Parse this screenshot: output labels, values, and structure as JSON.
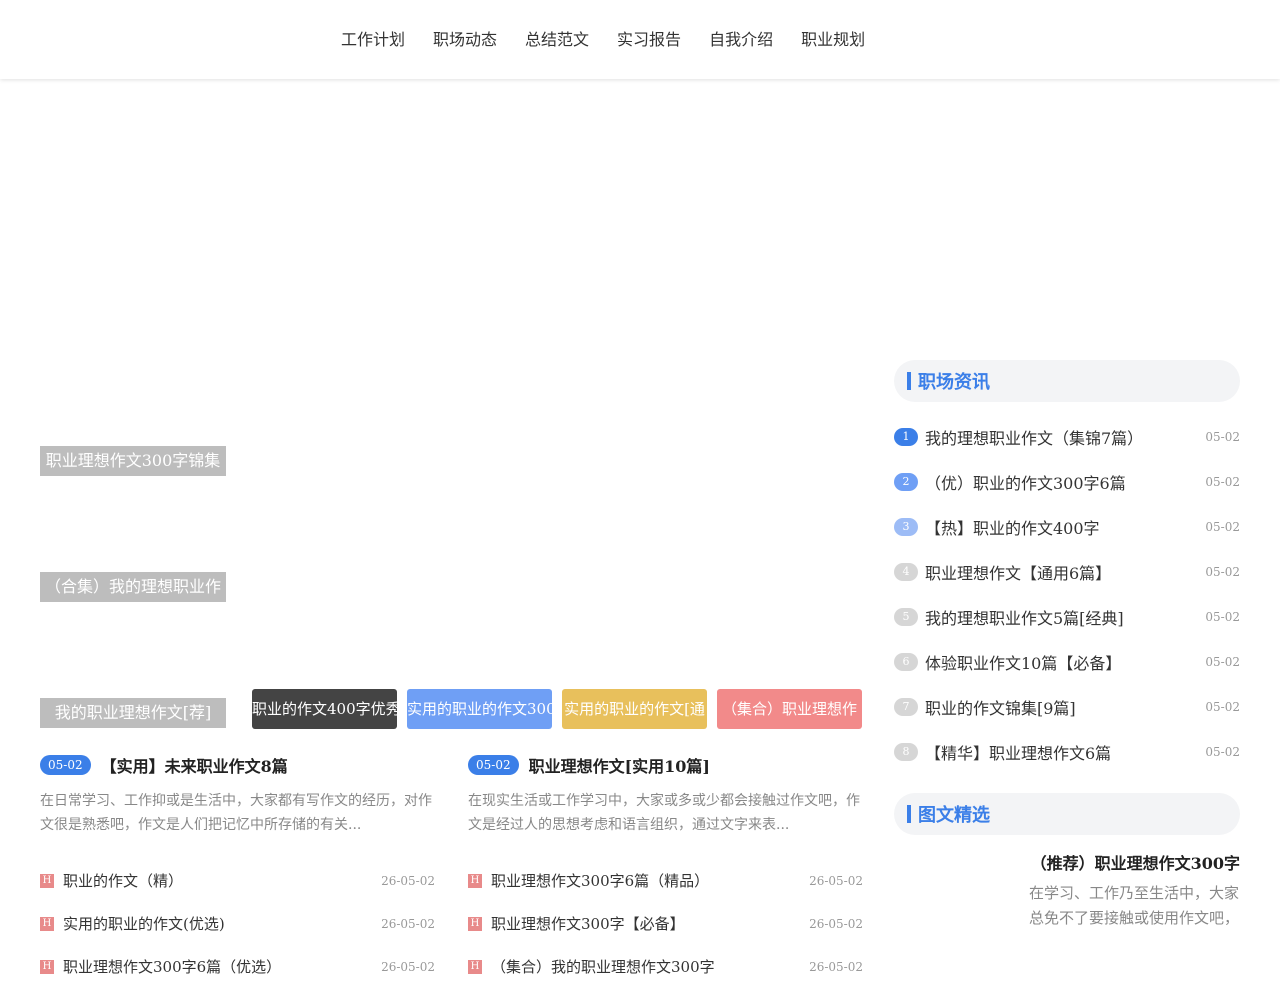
{
  "nav": [
    "工作计划",
    "职场动态",
    "总结范文",
    "实习报告",
    "自我介绍",
    "职业规划"
  ],
  "side_tags": [
    "职业理想作文300字锦集",
    "（合集）我的理想职业作",
    "我的职业理想作文[荐]"
  ],
  "tiles": [
    {
      "label": "职业的作文400字优秀",
      "color": "#444444"
    },
    {
      "label": "实用的职业的作文300",
      "color": "#6f9ff5"
    },
    {
      "label": "实用的职业的作文[通",
      "color": "#e8c05c"
    },
    {
      "label": "（集合）职业理想作",
      "color": "#f28a8a"
    }
  ],
  "articles": [
    {
      "date": "05-02",
      "title": "【实用】未来职业作文8篇",
      "excerpt": "在日常学习、工作抑或是生活中，大家都有写作文的经历，对作文很是熟悉吧，作文是人们把记忆中所存储的有关...",
      "list": [
        {
          "badge": "H",
          "title": "职业的作文（精）",
          "date": "26-05-02"
        },
        {
          "badge": "H",
          "title": "实用的职业的作文(优选)",
          "date": "26-05-02"
        },
        {
          "badge": "H",
          "title": "职业理想作文300字6篇（优选）",
          "date": "26-05-02"
        }
      ]
    },
    {
      "date": "05-02",
      "title": "职业理想作文[实用10篇]",
      "excerpt": "在现实生活或工作学习中，大家或多或少都会接触过作文吧，作文是经过人的思想考虑和语言组织，通过文字来表...",
      "list": [
        {
          "badge": "H",
          "title": "职业理想作文300字6篇（精品）",
          "date": "26-05-02"
        },
        {
          "badge": "H",
          "title": "职业理想作文300字【必备】",
          "date": "26-05-02"
        },
        {
          "badge": "H",
          "title": "（集合）我的职业理想作文300字",
          "date": "26-05-02"
        }
      ]
    }
  ],
  "sidebar": {
    "news_title": "职场资讯",
    "news": [
      {
        "n": "1",
        "title": "我的理想职业作文（集锦7篇）",
        "date": "05-02",
        "color": "#3b7fe8"
      },
      {
        "n": "2",
        "title": "（优）职业的作文300字6篇",
        "date": "05-02",
        "color": "#6f9ff5"
      },
      {
        "n": "3",
        "title": "【热】职业的作文400字",
        "date": "05-02",
        "color": "#9dbcf6"
      },
      {
        "n": "4",
        "title": "职业理想作文【通用6篇】",
        "date": "05-02",
        "color": "#d6d6d6"
      },
      {
        "n": "5",
        "title": "我的理想职业作文5篇[经典]",
        "date": "05-02",
        "color": "#d6d6d6"
      },
      {
        "n": "6",
        "title": "体验职业作文10篇【必备】",
        "date": "05-02",
        "color": "#d6d6d6"
      },
      {
        "n": "7",
        "title": "职业的作文锦集[9篇]",
        "date": "05-02",
        "color": "#d6d6d6"
      },
      {
        "n": "8",
        "title": "【精华】职业理想作文6篇",
        "date": "05-02",
        "color": "#d6d6d6"
      }
    ],
    "pick_title": "图文精选",
    "pick_item_title": "（推荐）职业理想作文300字",
    "pick_item_desc": "在学习、工作乃至生活中，大家总免不了要接触或使用作文吧，"
  }
}
